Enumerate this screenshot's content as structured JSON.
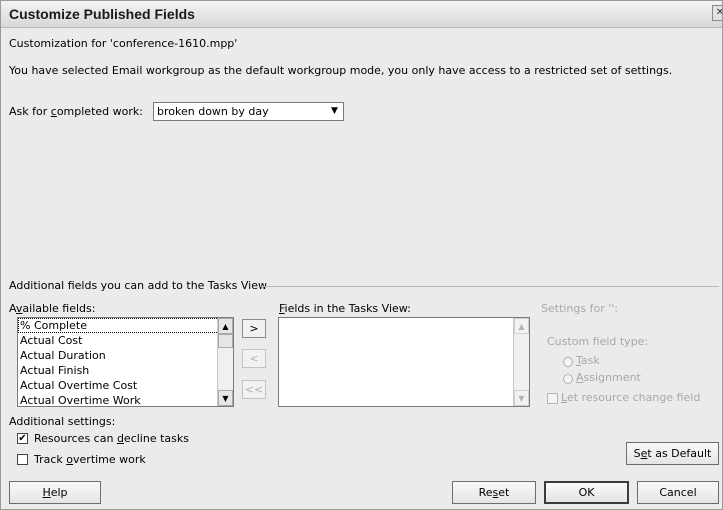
{
  "window": {
    "title": "Customize Published Fields"
  },
  "header": {
    "customization_for": "Customization for 'conference-1610.mpp'",
    "notice": "You have selected Email workgroup as the default workgroup mode, you only have access to a restricted set of settings."
  },
  "completed_work": {
    "label_prefix": "Ask for ",
    "label_accel": "c",
    "label_suffix": "ompleted work:",
    "value": "broken down by day"
  },
  "tasks_view": {
    "group_title": "Additional fields you can add to the Tasks View",
    "available_label_prefix": "A",
    "available_label_accel": "v",
    "available_label_suffix": "ailable fields:",
    "available_fields": [
      "% Complete",
      "Actual Cost",
      "Actual Duration",
      "Actual Finish",
      "Actual Overtime Cost",
      "Actual Overtime Work"
    ],
    "fields_label_accel": "F",
    "fields_label_suffix": "ields in the Tasks View:",
    "add_label": ">",
    "remove_label": "<",
    "remove_all_label": "<<"
  },
  "settings_for": {
    "label": "Settings for '':",
    "custom_field_type_label": "Custom field type:",
    "task_accel": "T",
    "task_rest": "ask",
    "assignment_accel": "A",
    "assignment_rest": "ssignment",
    "let_change_accel": "L",
    "let_change_rest": "et resource change field"
  },
  "additional_settings": {
    "label": "Additional settings:",
    "decline_prefix": "Resources can ",
    "decline_accel": "d",
    "decline_suffix": "ecline tasks",
    "decline_checked": true,
    "overtime_prefix": "Track ",
    "overtime_accel": "o",
    "overtime_suffix": "vertime work",
    "overtime_checked": false
  },
  "buttons": {
    "set_default_prefix": "S",
    "set_default_accel": "e",
    "set_default_suffix": "t as Default",
    "help_accel": "H",
    "help_rest": "elp",
    "reset_prefix": "Re",
    "reset_accel": "s",
    "reset_suffix": "et",
    "ok": "OK",
    "cancel": "Cancel"
  },
  "icons": {
    "check_mark": "✔",
    "dropdown_arrow": "▼",
    "scroll_up": "▲",
    "scroll_down": "▼",
    "close": "✕"
  }
}
